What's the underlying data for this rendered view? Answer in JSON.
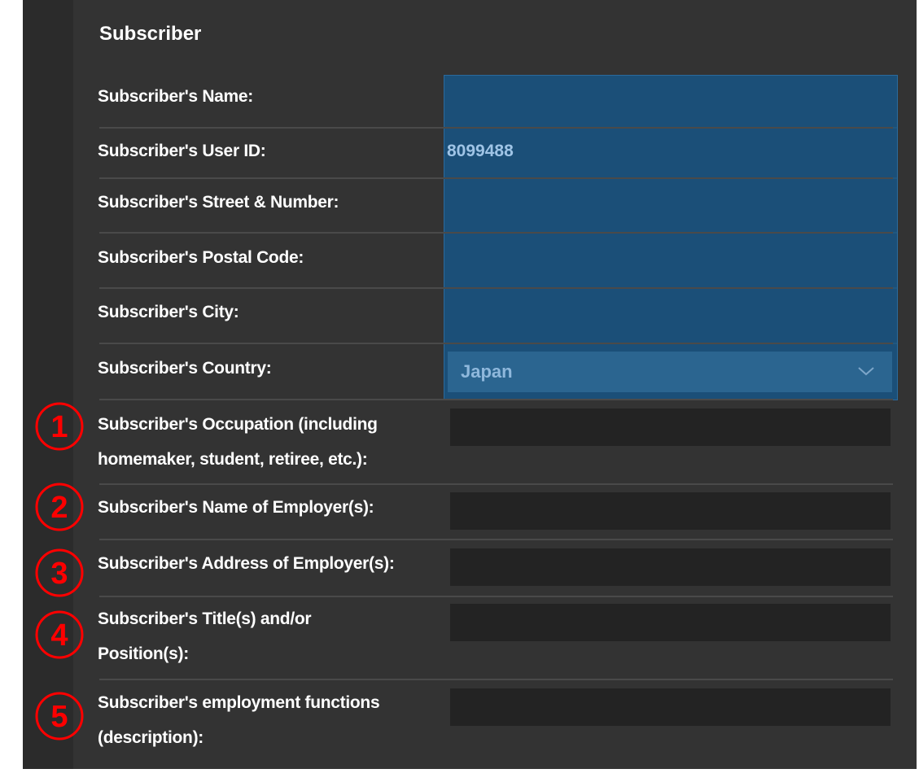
{
  "section": {
    "title": "Subscriber"
  },
  "fields": {
    "name": {
      "label": "Subscriber's Name:"
    },
    "user_id": {
      "label": "Subscriber's User ID:",
      "value": "8099488"
    },
    "street": {
      "label": "Subscriber's Street & Number:"
    },
    "postal": {
      "label": "Subscriber's Postal Code:"
    },
    "city": {
      "label": "Subscriber's City:"
    },
    "country": {
      "label": "Subscriber's Country:",
      "value": "Japan",
      "icon": "chevron-down-icon"
    },
    "occupation": {
      "label_line1": "Subscriber's Occupation (including",
      "label_line2": "homemaker, student, retiree, etc.):",
      "marker": "1"
    },
    "employer_name": {
      "label": "Subscriber's Name of Employer(s):",
      "marker": "2"
    },
    "employer_address": {
      "label": "Subscriber's Address of Employer(s):",
      "marker": "3"
    },
    "title_position": {
      "label_line1": "Subscriber's Title(s) and/or",
      "label_line2": "Position(s):",
      "marker": "4"
    },
    "employment_functions": {
      "label_line1": "Subscriber's employment functions",
      "label_line2": "(description):",
      "marker": "5"
    }
  },
  "colors": {
    "panel": "#333333",
    "highlight": "#1b4f78",
    "marker": "#ff0000"
  }
}
